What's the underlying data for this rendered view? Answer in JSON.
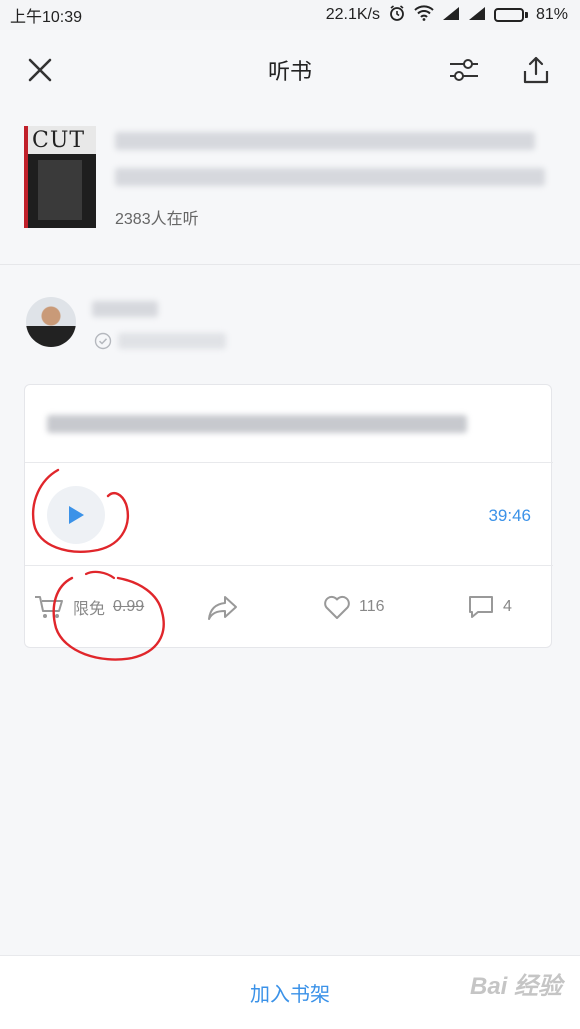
{
  "status_bar": {
    "time": "上午10:39",
    "network_speed": "22.1K/s",
    "battery_percent": "81%",
    "battery_level": 0.81
  },
  "nav": {
    "title": "听书",
    "close_icon": "close-icon",
    "settings_icon": "sliders-icon",
    "share_icon": "share-icon"
  },
  "book": {
    "listeners": "2383人在听"
  },
  "card": {
    "duration": "39:46",
    "price_label": "限免",
    "price_value": "0.99",
    "likes": "116",
    "comments": "4"
  },
  "bottom": {
    "add_to_shelf": "加入书架"
  },
  "watermark": {
    "text": "Bai 经验"
  },
  "colors": {
    "accent": "#3b92e8",
    "annotation": "#e0262b"
  }
}
